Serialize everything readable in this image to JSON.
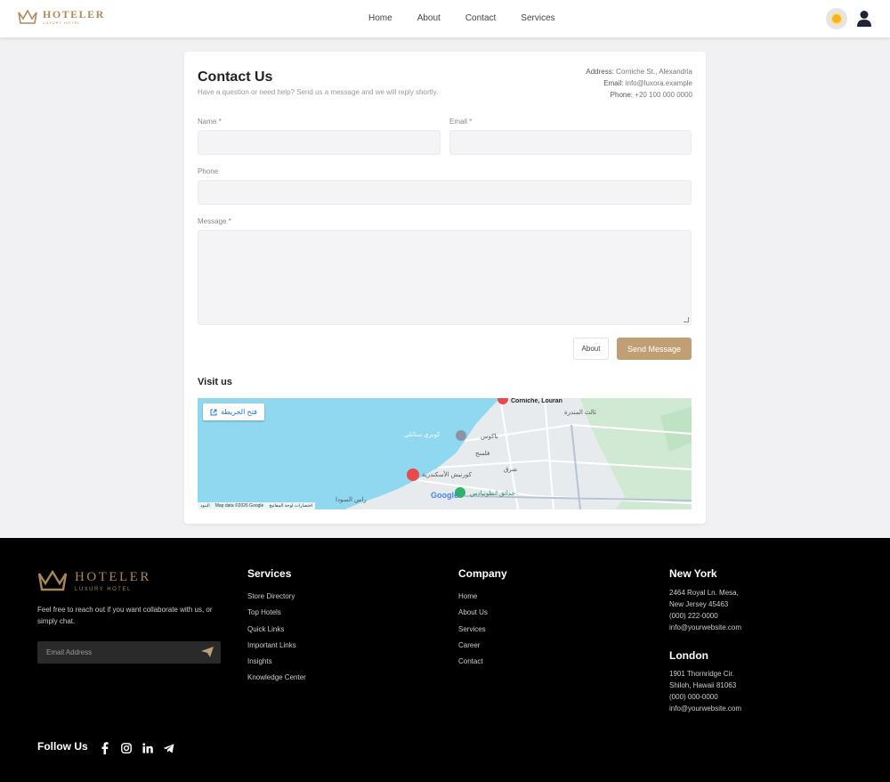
{
  "header": {
    "logo_name": "HOTELER",
    "logo_sub": "LUXURY HOTEL",
    "nav": [
      {
        "label": "Home"
      },
      {
        "label": "About"
      },
      {
        "label": "Contact"
      },
      {
        "label": "Services"
      }
    ]
  },
  "contact": {
    "title": "Contact Us",
    "subtitle": "Have a question or need help? Send us a message and we will reply shortly.",
    "address_label": "Address:",
    "address_value": "Corniche St., Alexandria",
    "email_label": "Email:",
    "email_value": "info@luxora.example",
    "phone_label": "Phone:",
    "phone_value": "+20 100 000 0000",
    "fields": {
      "name_label": "Name *",
      "email_label": "Email *",
      "phone_label": "Phone",
      "message_label": "Message *"
    },
    "about_button": "About",
    "send_button": "Send Message",
    "visit_title": "Visit us"
  },
  "map": {
    "open_button": "فتح الخريطة",
    "google_label": "Google",
    "credit_1": "البنود",
    "credit_2": "Map data ©2026 Google",
    "credit_3": "اختصارات لوحة المفاتيح",
    "labels": {
      "corniche": "Corniche, Louran",
      "bakos": "باكوس",
      "feleming": "فلمنج",
      "sharq": "شرق",
      "corniche_ar": "كورنيش الأسكندرية",
      "stanley": "كوبري ستانلي",
      "antoniadis": "حدائق انطونيادس",
      "ras": "راس السودا",
      "sidi": "ثالث المندرة"
    }
  },
  "footer": {
    "logo_name": "HOTELER",
    "logo_sub": "LUXURY HOTEL",
    "about_text": "Feel free to reach out if you want collaborate with us, or simply chat.",
    "email_placeholder": "Email Address",
    "services_title": "Services",
    "services": [
      "Store Directory",
      "Top Hotels",
      "Quick Links",
      "Important Links",
      "Insights",
      "Knowledge Center"
    ],
    "company_title": "Company",
    "company": [
      "Home",
      "About Us",
      "Services",
      "Career",
      "Contact"
    ],
    "ny_title": "New York",
    "ny_lines": [
      "2464 Royal Ln. Mesa,",
      "New Jersey 45463",
      "(000) 222-0000",
      "info@yourwebsite.com"
    ],
    "london_title": "London",
    "london_lines": [
      "1901 Thornridge Cir.",
      "Shiloh, Hawaii 81063",
      "(000) 000-0000",
      "info@yourwebsite.com"
    ],
    "follow_title": "Follow Us",
    "social_icons": [
      "facebook-icon",
      "instagram-icon",
      "linkedin-icon",
      "telegram-icon"
    ]
  }
}
